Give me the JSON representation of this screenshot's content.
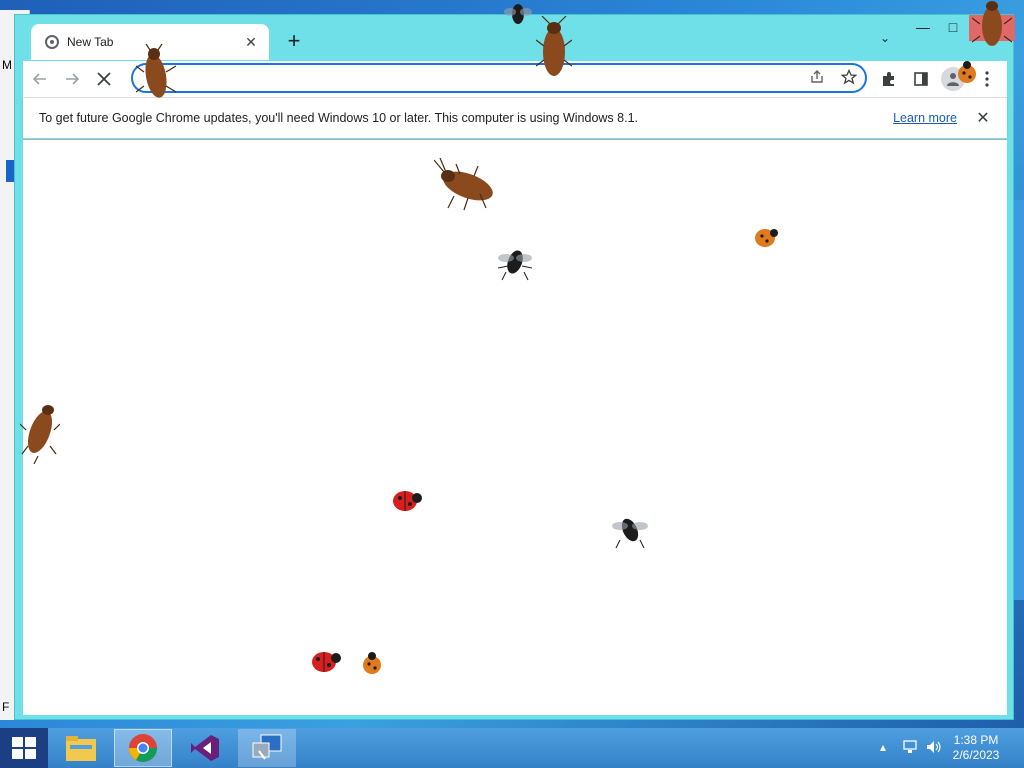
{
  "browser": {
    "tab": {
      "title": "New Tab",
      "close_label": "✕"
    },
    "new_tab_label": "+",
    "tab_search_label": "⌄",
    "window_controls": {
      "minimize": "—",
      "maximize": "□"
    },
    "omnibox": {
      "value": "",
      "placeholder": ""
    },
    "infobar": {
      "message": "To get future Google Chrome updates, you'll need Windows 10 or later. This computer is using Windows 8.1.",
      "link_label": "Learn more",
      "close_label": "✕"
    },
    "page_url_state": "loading"
  },
  "taskbar": {
    "apps": [
      {
        "name": "File Explorer"
      },
      {
        "name": "Google Chrome"
      },
      {
        "name": "Visual Studio"
      },
      {
        "name": "Remote Desktop"
      }
    ],
    "clock": {
      "time": "1:38 PM",
      "date": "2/6/2023"
    }
  },
  "background_fragments": {
    "left_text_1": "M",
    "left_text_2": "F"
  },
  "colors": {
    "window_frame": "#6fe0e8",
    "omnibox_focus": "#1a73e8",
    "link": "#1a5fb4",
    "close_hover": "#e06868",
    "taskbar": "#3b8bd4"
  }
}
